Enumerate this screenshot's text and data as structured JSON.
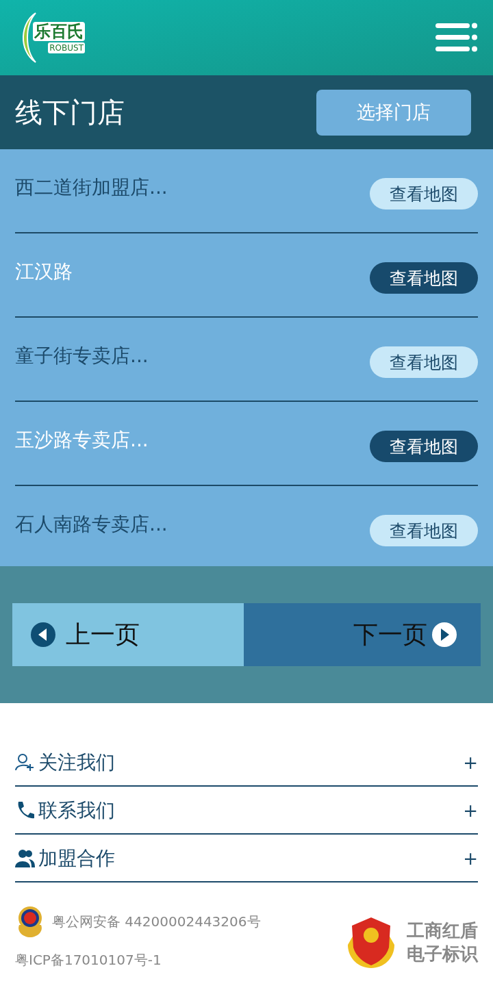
{
  "header": {
    "logo": {
      "name": "乐百氏",
      "sub": "ROBUST"
    }
  },
  "title_bar": {
    "title": "线下门店",
    "button": "选择门店"
  },
  "stores": [
    {
      "name": "西二道街加盟店...",
      "button": "查看地图",
      "highlighted": false
    },
    {
      "name": "江汉路",
      "button": "查看地图",
      "highlighted": true
    },
    {
      "name": "童子街专卖店...",
      "button": "查看地图",
      "highlighted": false
    },
    {
      "name": "玉沙路专卖店...",
      "button": "查看地图",
      "highlighted": true
    },
    {
      "name": "石人南路专卖店...",
      "button": "查看地图",
      "highlighted": false
    }
  ],
  "pager": {
    "prev": "上一页",
    "next": "下一页"
  },
  "footer_links": [
    {
      "kind": "follow",
      "label": "关注我们",
      "toggle": "+"
    },
    {
      "kind": "phone",
      "label": "联系我们",
      "toggle": "+"
    },
    {
      "kind": "group",
      "label": "加盟合作",
      "toggle": "+"
    }
  ],
  "credits": {
    "police": "粤公网安备 44200002443206号",
    "icp": "粤ICP备17010107号-1",
    "badge": [
      "工商红盾",
      "电子标识"
    ]
  }
}
